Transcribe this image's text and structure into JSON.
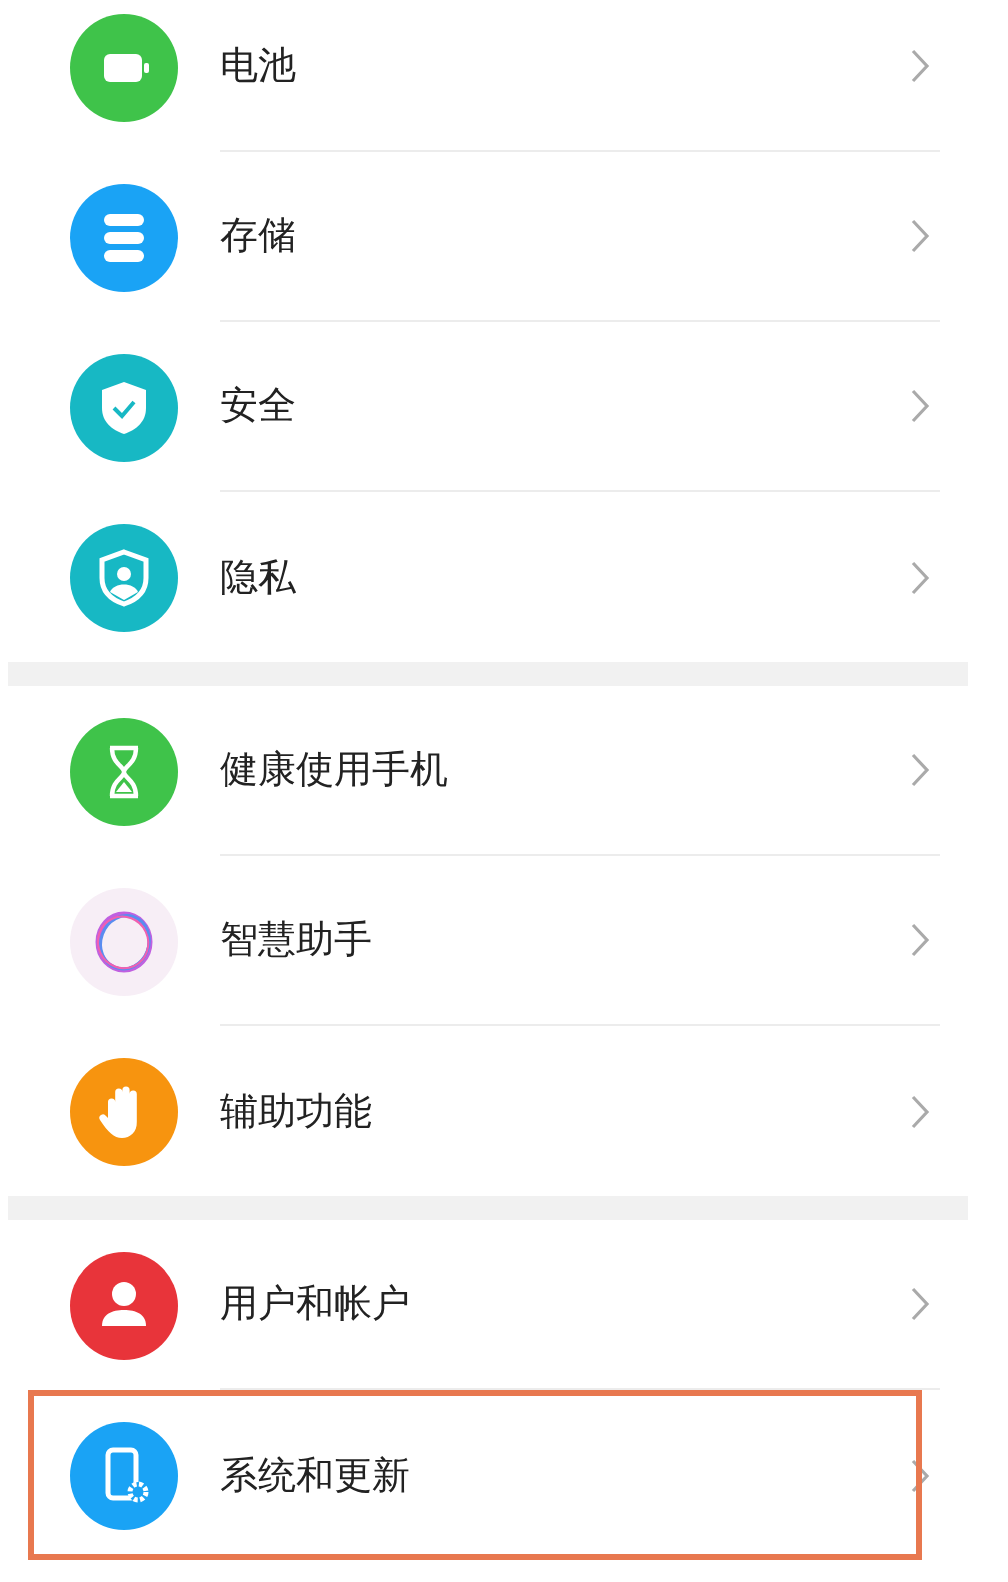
{
  "groups": [
    {
      "items": [
        {
          "label": "电池",
          "highlighted": false
        },
        {
          "label": "存储",
          "highlighted": false
        },
        {
          "label": "安全",
          "highlighted": false
        },
        {
          "label": "隐私",
          "highlighted": false
        }
      ]
    },
    {
      "items": [
        {
          "label": "健康使用手机",
          "highlighted": false
        },
        {
          "label": "智慧助手",
          "highlighted": false
        },
        {
          "label": "辅助功能",
          "highlighted": false
        }
      ]
    },
    {
      "items": [
        {
          "label": "用户和帐户",
          "highlighted": false
        },
        {
          "label": "系统和更新",
          "highlighted": true
        }
      ]
    }
  ]
}
